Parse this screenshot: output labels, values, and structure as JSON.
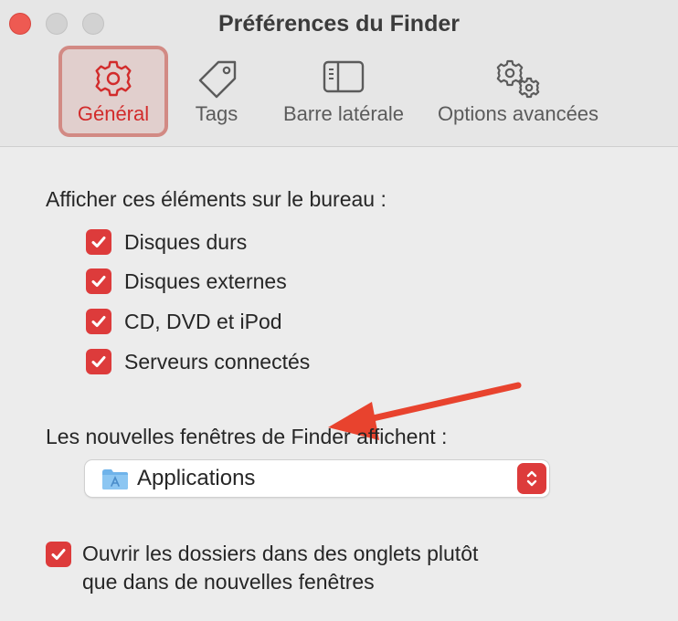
{
  "window": {
    "title": "Préférences du Finder"
  },
  "tabs": [
    {
      "label": "Général",
      "icon": "gear-icon",
      "active": true
    },
    {
      "label": "Tags",
      "icon": "tag-icon",
      "active": false
    },
    {
      "label": "Barre latérale",
      "icon": "sidebar-icon",
      "active": false
    },
    {
      "label": "Options avancées",
      "icon": "gears-icon",
      "active": false
    }
  ],
  "desktop": {
    "label": "Afficher ces éléments sur le bureau :",
    "items": [
      {
        "label": "Disques durs",
        "checked": true
      },
      {
        "label": "Disques externes",
        "checked": true
      },
      {
        "label": "CD, DVD et iPod",
        "checked": true
      },
      {
        "label": "Serveurs connectés",
        "checked": true
      }
    ]
  },
  "new_windows": {
    "label": "Les nouvelles fenêtres de Finder affichent :",
    "selected": "Applications",
    "icon": "applications-folder-icon"
  },
  "open_in_tabs": {
    "line1": "Ouvrir les dossiers dans des onglets plutôt",
    "line2": "que dans de nouvelles fenêtres",
    "checked": true
  },
  "colors": {
    "accent": "#dd3b3b",
    "annotation_arrow": "#e8432e",
    "active_tab_border": "#d28a84"
  }
}
